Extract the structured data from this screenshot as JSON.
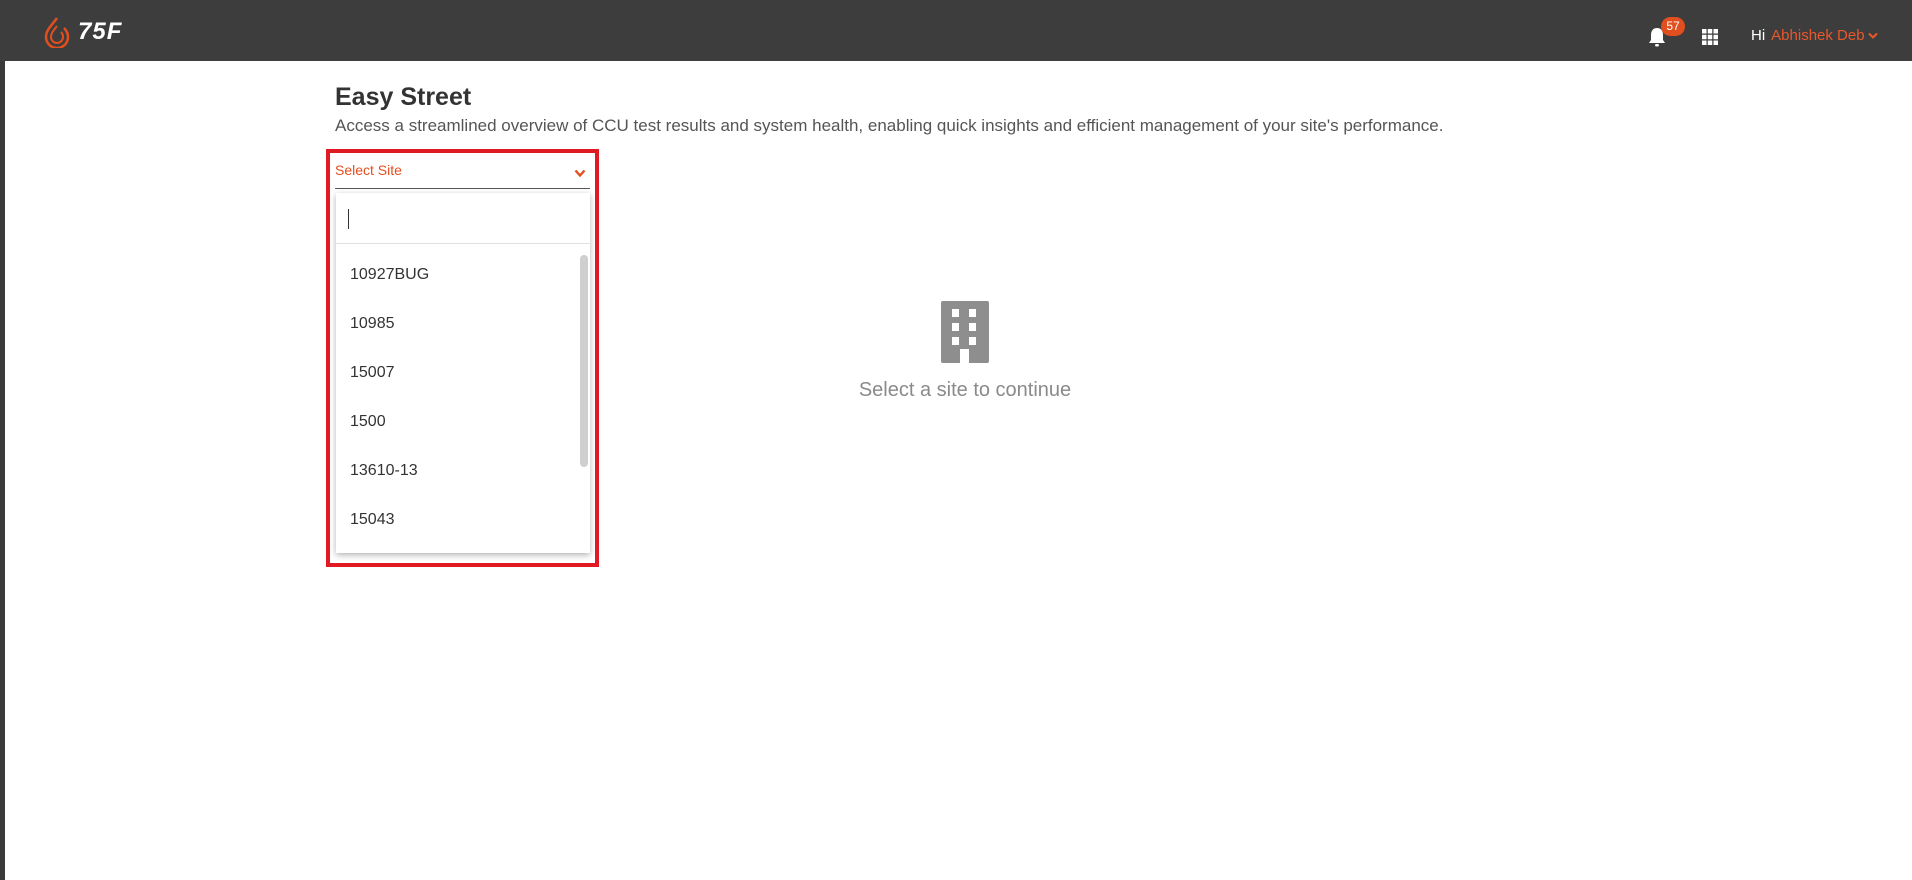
{
  "header": {
    "logo_text": "75F",
    "notification_count": "57",
    "greeting": "Hi",
    "user_name": "Abhishek Deb",
    "brand_color": "#e24f1f"
  },
  "page": {
    "title": "Easy Street",
    "subtitle": "Access a streamlined overview of CCU test results and system health, enabling quick insights and efficient management of your site's performance."
  },
  "site_select": {
    "label": "Select Site",
    "search_value": "",
    "options": [
      "10927BUG",
      "10985",
      "15007",
      "1500",
      "13610-13",
      "15043"
    ]
  },
  "empty_state": {
    "message": "Select a site to continue",
    "icon": "building-icon"
  }
}
